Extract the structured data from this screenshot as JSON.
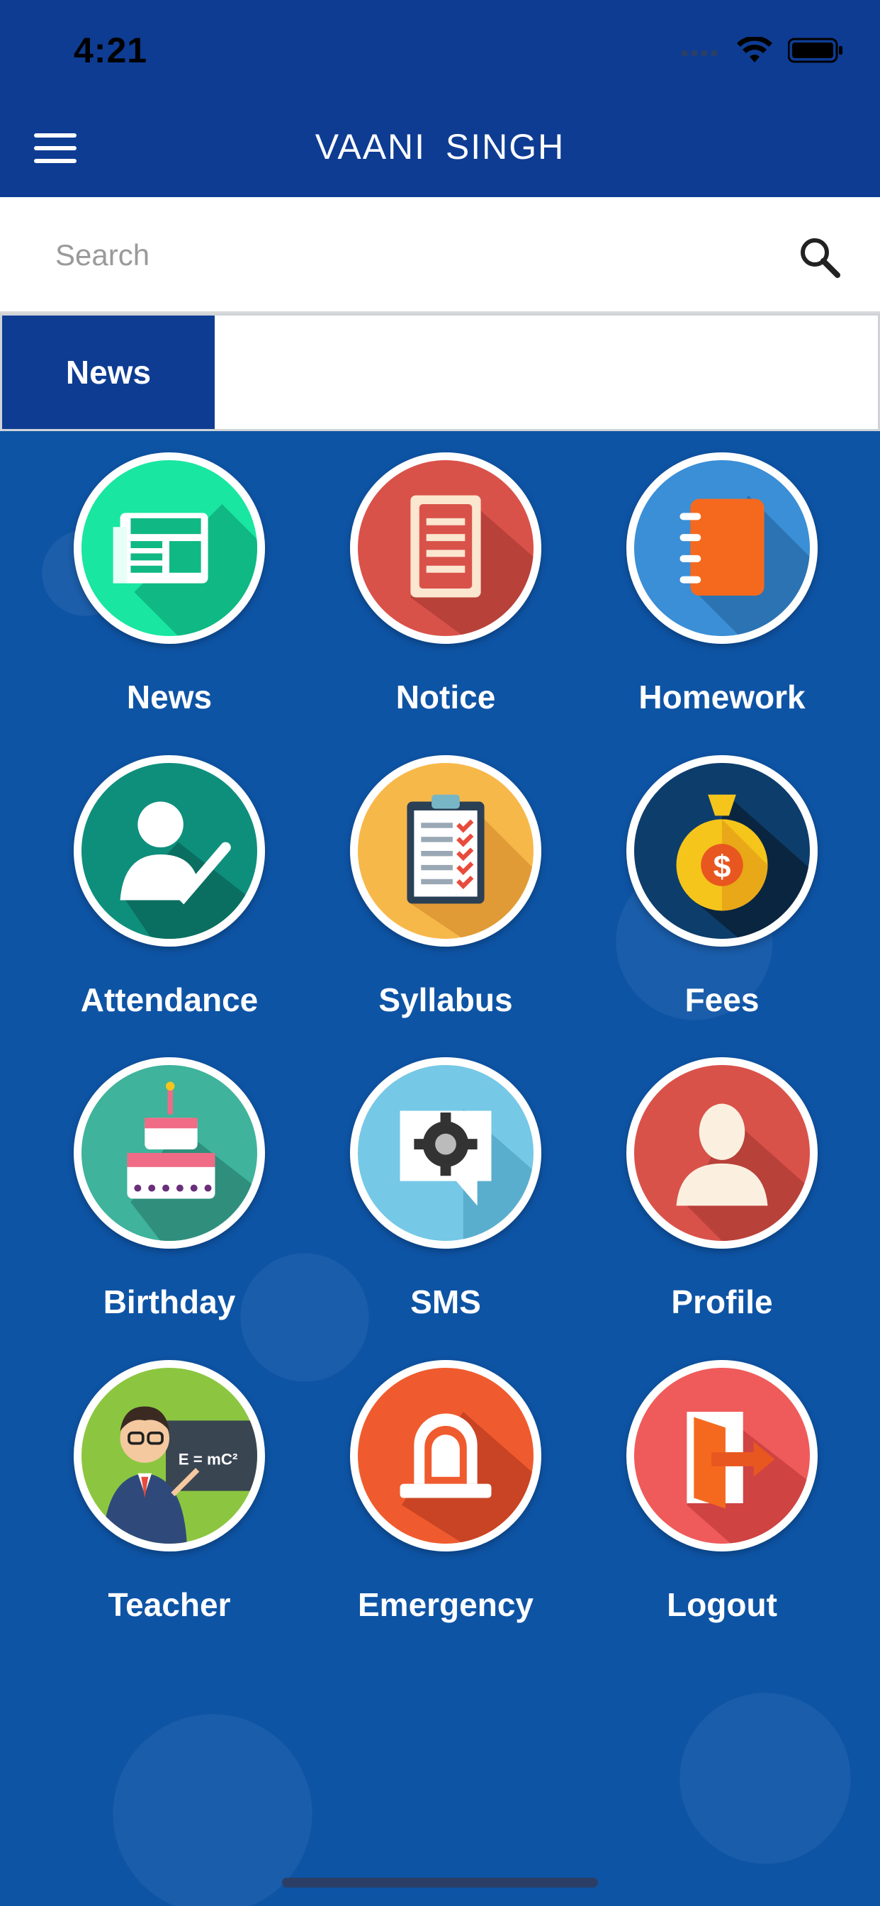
{
  "status_bar": {
    "time": "4:21"
  },
  "header": {
    "title": "VAANI  SINGH"
  },
  "search": {
    "placeholder": "Search"
  },
  "ticker": {
    "tab_label": "News",
    "content": ""
  },
  "tiles": [
    {
      "label": "News",
      "icon": "newspaper-icon",
      "color": "#19e6a0"
    },
    {
      "label": "Notice",
      "icon": "notice-document-icon",
      "color": "#d9524a"
    },
    {
      "label": "Homework",
      "icon": "notebook-icon",
      "color": "#3a8fd6"
    },
    {
      "label": "Attendance",
      "icon": "attendance-person-check-icon",
      "color": "#0e8f7c"
    },
    {
      "label": "Syllabus",
      "icon": "clipboard-checklist-icon",
      "color": "#f7b84a"
    },
    {
      "label": "Fees",
      "icon": "money-bag-icon",
      "color": "#0d3d6b"
    },
    {
      "label": "Birthday",
      "icon": "birthday-cake-icon",
      "color": "#3fb39b"
    },
    {
      "label": "SMS",
      "icon": "message-gear-icon",
      "color": "#75c8e6"
    },
    {
      "label": "Profile",
      "icon": "user-silhouette-icon",
      "color": "#d9524a"
    },
    {
      "label": "Teacher",
      "icon": "teacher-icon",
      "color": "#8cc640"
    },
    {
      "label": "Emergency",
      "icon": "siren-icon",
      "color": "#ef5b2e"
    },
    {
      "label": "Logout",
      "icon": "logout-door-icon",
      "color": "#ef5b5b"
    }
  ]
}
